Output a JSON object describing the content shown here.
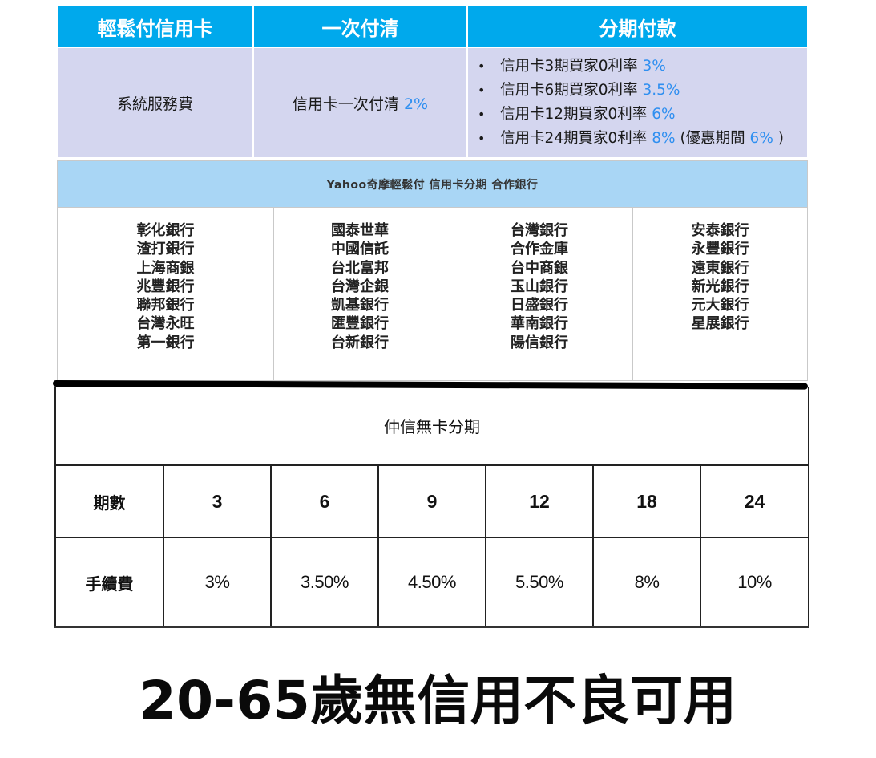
{
  "fee_table": {
    "headers": [
      "輕鬆付信用卡",
      "一次付清",
      "分期付款"
    ],
    "service_fee_label": "系統服務費",
    "one_time": {
      "label": "信用卡一次付清",
      "rate": "2%"
    },
    "installments": [
      {
        "label": "信用卡3期買家0利率",
        "rate": "3%",
        "suffix_before": "",
        "note_rate": "",
        "suffix_after": ""
      },
      {
        "label": "信用卡6期買家0利率",
        "rate": "3.5%",
        "suffix_before": "",
        "note_rate": "",
        "suffix_after": ""
      },
      {
        "label": "信用卡12期買家0利率",
        "rate": "6%",
        "suffix_before": "",
        "note_rate": "",
        "suffix_after": ""
      },
      {
        "label": "信用卡24期買家0利率",
        "rate": "8%",
        "suffix_before": " (優惠期間 ",
        "note_rate": "6%",
        "suffix_after": " )"
      }
    ]
  },
  "bank_table": {
    "header": "Yahoo奇摩輕鬆付 信用卡分期 合作銀行",
    "columns": [
      [
        "彰化銀行",
        "渣打銀行",
        "上海商銀",
        "兆豐銀行",
        "聯邦銀行",
        "台灣永旺",
        "第一銀行"
      ],
      [
        "國泰世華",
        "中國信託",
        "台北富邦",
        "台灣企銀",
        "凱基銀行",
        "匯豐銀行",
        "台新銀行"
      ],
      [
        "台灣銀行",
        "合作金庫",
        "台中商銀",
        "玉山銀行",
        "日盛銀行",
        "華南銀行",
        "陽信銀行"
      ],
      [
        "安泰銀行",
        "永豐銀行",
        "遠東銀行",
        "新光銀行",
        "元大銀行",
        "星展銀行"
      ]
    ]
  },
  "cardless_table": {
    "title": "仲信無卡分期",
    "period_label": "期數",
    "periods": [
      "3",
      "6",
      "9",
      "12",
      "18",
      "24"
    ],
    "fee_label": "手續費",
    "fees": [
      "3%",
      "3.50%",
      "4.50%",
      "5.50%",
      "8%",
      "10%"
    ]
  },
  "footer": {
    "text": "20-65歲無信用不良可用"
  },
  "colors": {
    "header_blue": "#00a9ec",
    "lavender": "#d4d6ef",
    "light_blue": "#a9d6f5",
    "accent": "#2f8ff0"
  }
}
